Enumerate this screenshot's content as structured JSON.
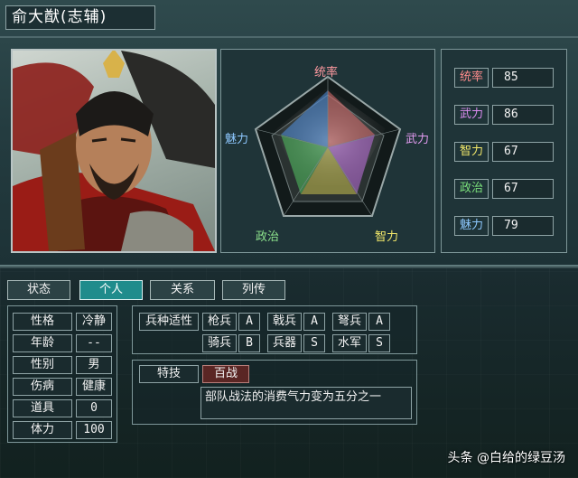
{
  "title": "俞大猷(志辅)",
  "radar": {
    "labels": {
      "top": "统率",
      "right": "武力",
      "bottom_right": "智力",
      "bottom_left": "政治",
      "left": "魅力"
    },
    "label_colors": {
      "top": "#ff9aa0",
      "right": "#e49cf2",
      "bottom_right": "#f2e86a",
      "bottom_left": "#8ce28c",
      "left": "#8ec8ff"
    }
  },
  "stats": [
    {
      "label": "统率",
      "value": "85",
      "color": "#ff8c8c"
    },
    {
      "label": "武力",
      "value": "86",
      "color": "#dc8cf0"
    },
    {
      "label": "智力",
      "value": "67",
      "color": "#f2e86a"
    },
    {
      "label": "政治",
      "value": "67",
      "color": "#7be07b"
    },
    {
      "label": "魅力",
      "value": "79",
      "color": "#8ec8ff"
    }
  ],
  "tabs": [
    "状态",
    "个人",
    "关系",
    "列传"
  ],
  "active_tab": "个人",
  "personal": [
    {
      "label": "性格",
      "value": "冷静"
    },
    {
      "label": "年龄",
      "value": "--"
    },
    {
      "label": "性别",
      "value": "男"
    },
    {
      "label": "伤病",
      "value": "健康"
    },
    {
      "label": "道具",
      "value": "0"
    },
    {
      "label": "体力",
      "value": "100"
    }
  ],
  "aptitude": {
    "header": "兵种适性",
    "units": [
      {
        "name": "枪兵",
        "grade": "A"
      },
      {
        "name": "戟兵",
        "grade": "A"
      },
      {
        "name": "弩兵",
        "grade": "A"
      },
      {
        "name": "骑兵",
        "grade": "B"
      },
      {
        "name": "兵器",
        "grade": "S"
      },
      {
        "name": "水军",
        "grade": "S"
      }
    ]
  },
  "skill": {
    "label": "特技",
    "name": "百战",
    "description": "部队战法的消费气力变为五分之一"
  },
  "watermark": "头条 @白给的绿豆汤"
}
